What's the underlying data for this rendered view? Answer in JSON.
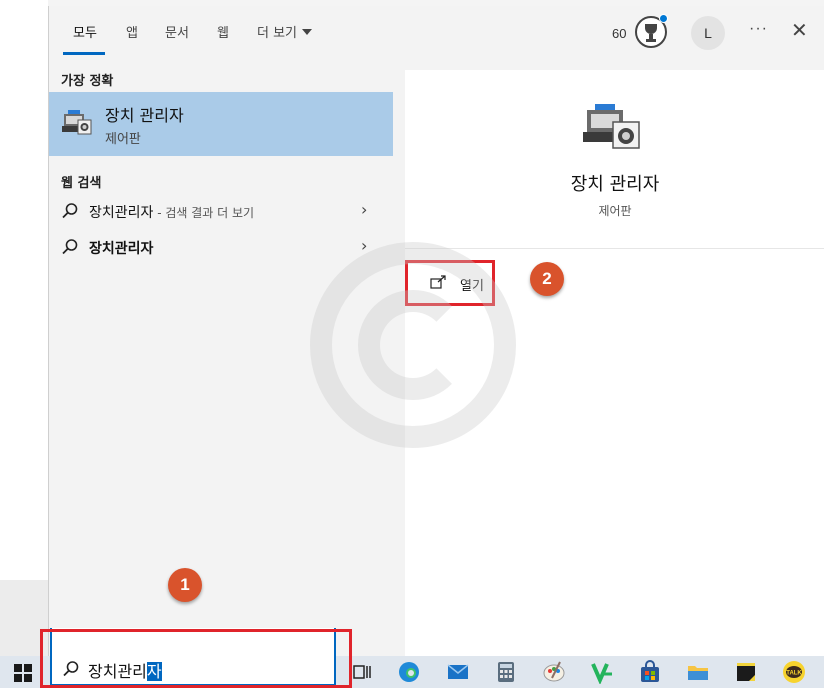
{
  "tabs": [
    {
      "label": "모두",
      "active": true
    },
    {
      "label": "앱"
    },
    {
      "label": "문서"
    },
    {
      "label": "웹"
    },
    {
      "label": "더 보기"
    }
  ],
  "header": {
    "points": "60",
    "avatar_initial": "L",
    "more_label": "···",
    "close_label": "✕"
  },
  "best_match": {
    "section_title": "가장 정확",
    "title": "장치 관리자",
    "subtitle": "제어판",
    "icon": "device-manager-icon"
  },
  "web_search": {
    "section_title": "웹 검색",
    "results": [
      {
        "query": "장치관리자",
        "hint": " - 검색 결과 더 보기"
      },
      {
        "query": "장치관리자",
        "hint": ""
      }
    ]
  },
  "preview": {
    "title": "장치 관리자",
    "subtitle": "제어판",
    "action_label": "열기"
  },
  "steps": {
    "step1": "1",
    "step2": "2"
  },
  "search": {
    "typed": "장치관리",
    "selected": "자"
  },
  "taskbar": {
    "icons": [
      "task-view-icon",
      "edge-icon",
      "mail-icon",
      "calculator-icon",
      "paint-icon",
      "app-v-icon",
      "store-icon",
      "file-explorer-icon",
      "sticky-notes-icon",
      "kakaotalk-icon"
    ]
  },
  "colors": {
    "accent": "#0067c0",
    "selection": "#aacbe8",
    "highlight_red": "#e0242b",
    "badge": "#d9532c"
  }
}
